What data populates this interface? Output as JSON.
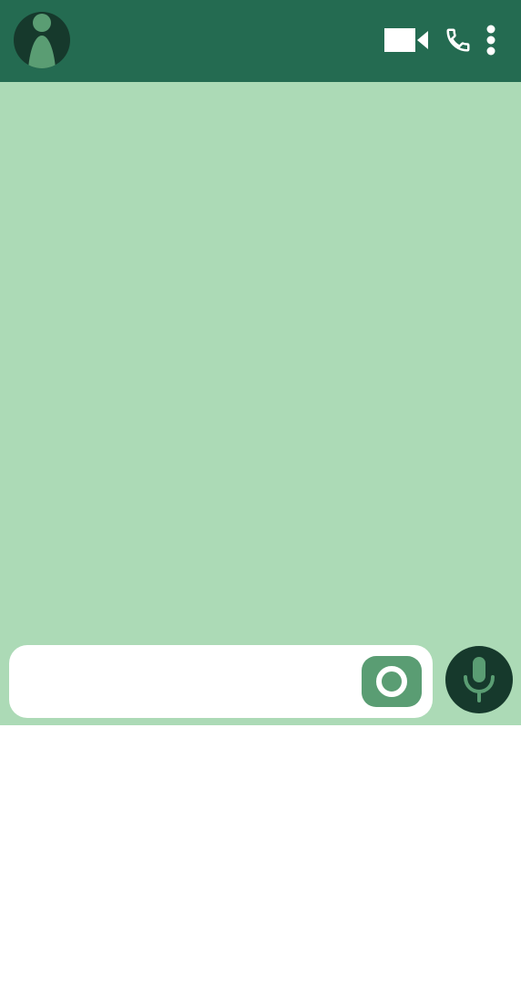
{
  "header": {
    "contact_name": "",
    "icons": {
      "avatar": "person-avatar-icon",
      "video": "video-camera-icon",
      "call": "phone-icon",
      "more": "more-vertical-icon"
    }
  },
  "composer": {
    "input_value": "",
    "input_placeholder": "",
    "camera_icon": "camera-icon",
    "mic_icon": "microphone-icon"
  },
  "colors": {
    "header_bg": "#246b51",
    "chat_bg": "#acdab6",
    "avatar_bg": "#16392c",
    "accent": "#5a9d73",
    "mic_bg": "#16392c"
  }
}
